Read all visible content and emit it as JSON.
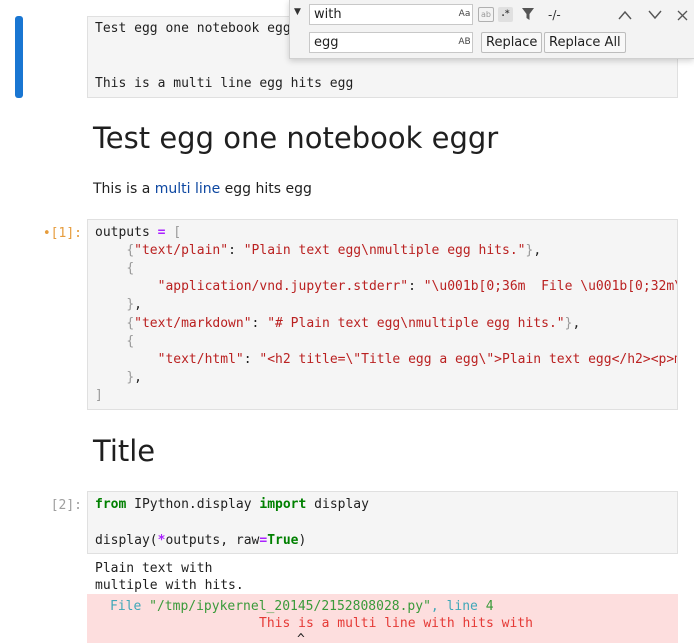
{
  "cell1": {
    "lines": [
      "Test egg one notebook eggr",
      "",
      "This is a multi line egg hits egg"
    ]
  },
  "markdown1": {
    "heading": "Test egg one notebook eggr",
    "para_before": "This is a ",
    "para_link": "multi line",
    "para_after": " egg hits egg"
  },
  "cell2": {
    "prompt": "•[1]:",
    "var": "outputs",
    "eq": "=",
    "open": "[",
    "entry1_key": "\"text/plain\"",
    "entry1_val": "\"Plain text egg\\nmultiple egg hits.\"",
    "entry2_key": "\"application/vnd.jupyter.stderr\"",
    "entry2_val": "\"\\u001b[0;36m  File \\u001b[0;32m\\",
    "entry3_key": "\"text/markdown\"",
    "entry3_val": "\"# Plain text egg\\nmultiple egg hits.\"",
    "entry4_key": "\"text/html\"",
    "entry4_val": "\"<h2 title=\\\"Title egg a egg\\\">Plain text egg</h2><p>m",
    "close": "]"
  },
  "markdown2": {
    "heading": "Title"
  },
  "cell3": {
    "prompt": "[2]:",
    "line1_from": "from",
    "line1_mod": " IPython.display ",
    "line1_import": "import",
    "line1_name": " display",
    "line2_fn": "display(",
    "line2_star": "*",
    "line2_args": "outputs, raw",
    "line2_eq": "=",
    "line2_true": "True",
    "line2_close": ")"
  },
  "output3": {
    "text_lines": [
      "Plain text with",
      "multiple with hits."
    ],
    "err_file_label": "File",
    "err_path": "\"/tmp/ipykernel_20145/2152808028.py\"",
    "err_sep": ",",
    "err_line_label": "line",
    "err_line_no": "4",
    "err_msg": "This is a multi line with hits with",
    "err_caret": "^"
  },
  "find_widget": {
    "toggle_icon": "caret-down",
    "find_value": "with",
    "replace_value": "egg",
    "match_case_label": "Aa",
    "whole_word_label": "ab",
    "regex_label": ".*",
    "preserve_case_label": "AB",
    "filter_icon": "filter",
    "count": "-/-",
    "prev_icon": "chevron-up",
    "next_icon": "chevron-down",
    "close_icon": "close",
    "replace_label": "Replace",
    "replace_all_label": "Replace All"
  },
  "colors": {
    "active_bar": "#1976d2",
    "keyword": "#008000",
    "string": "#ba2121",
    "operator": "#aa22ff",
    "error_bg": "#fddede",
    "link": "#0d47a1"
  }
}
